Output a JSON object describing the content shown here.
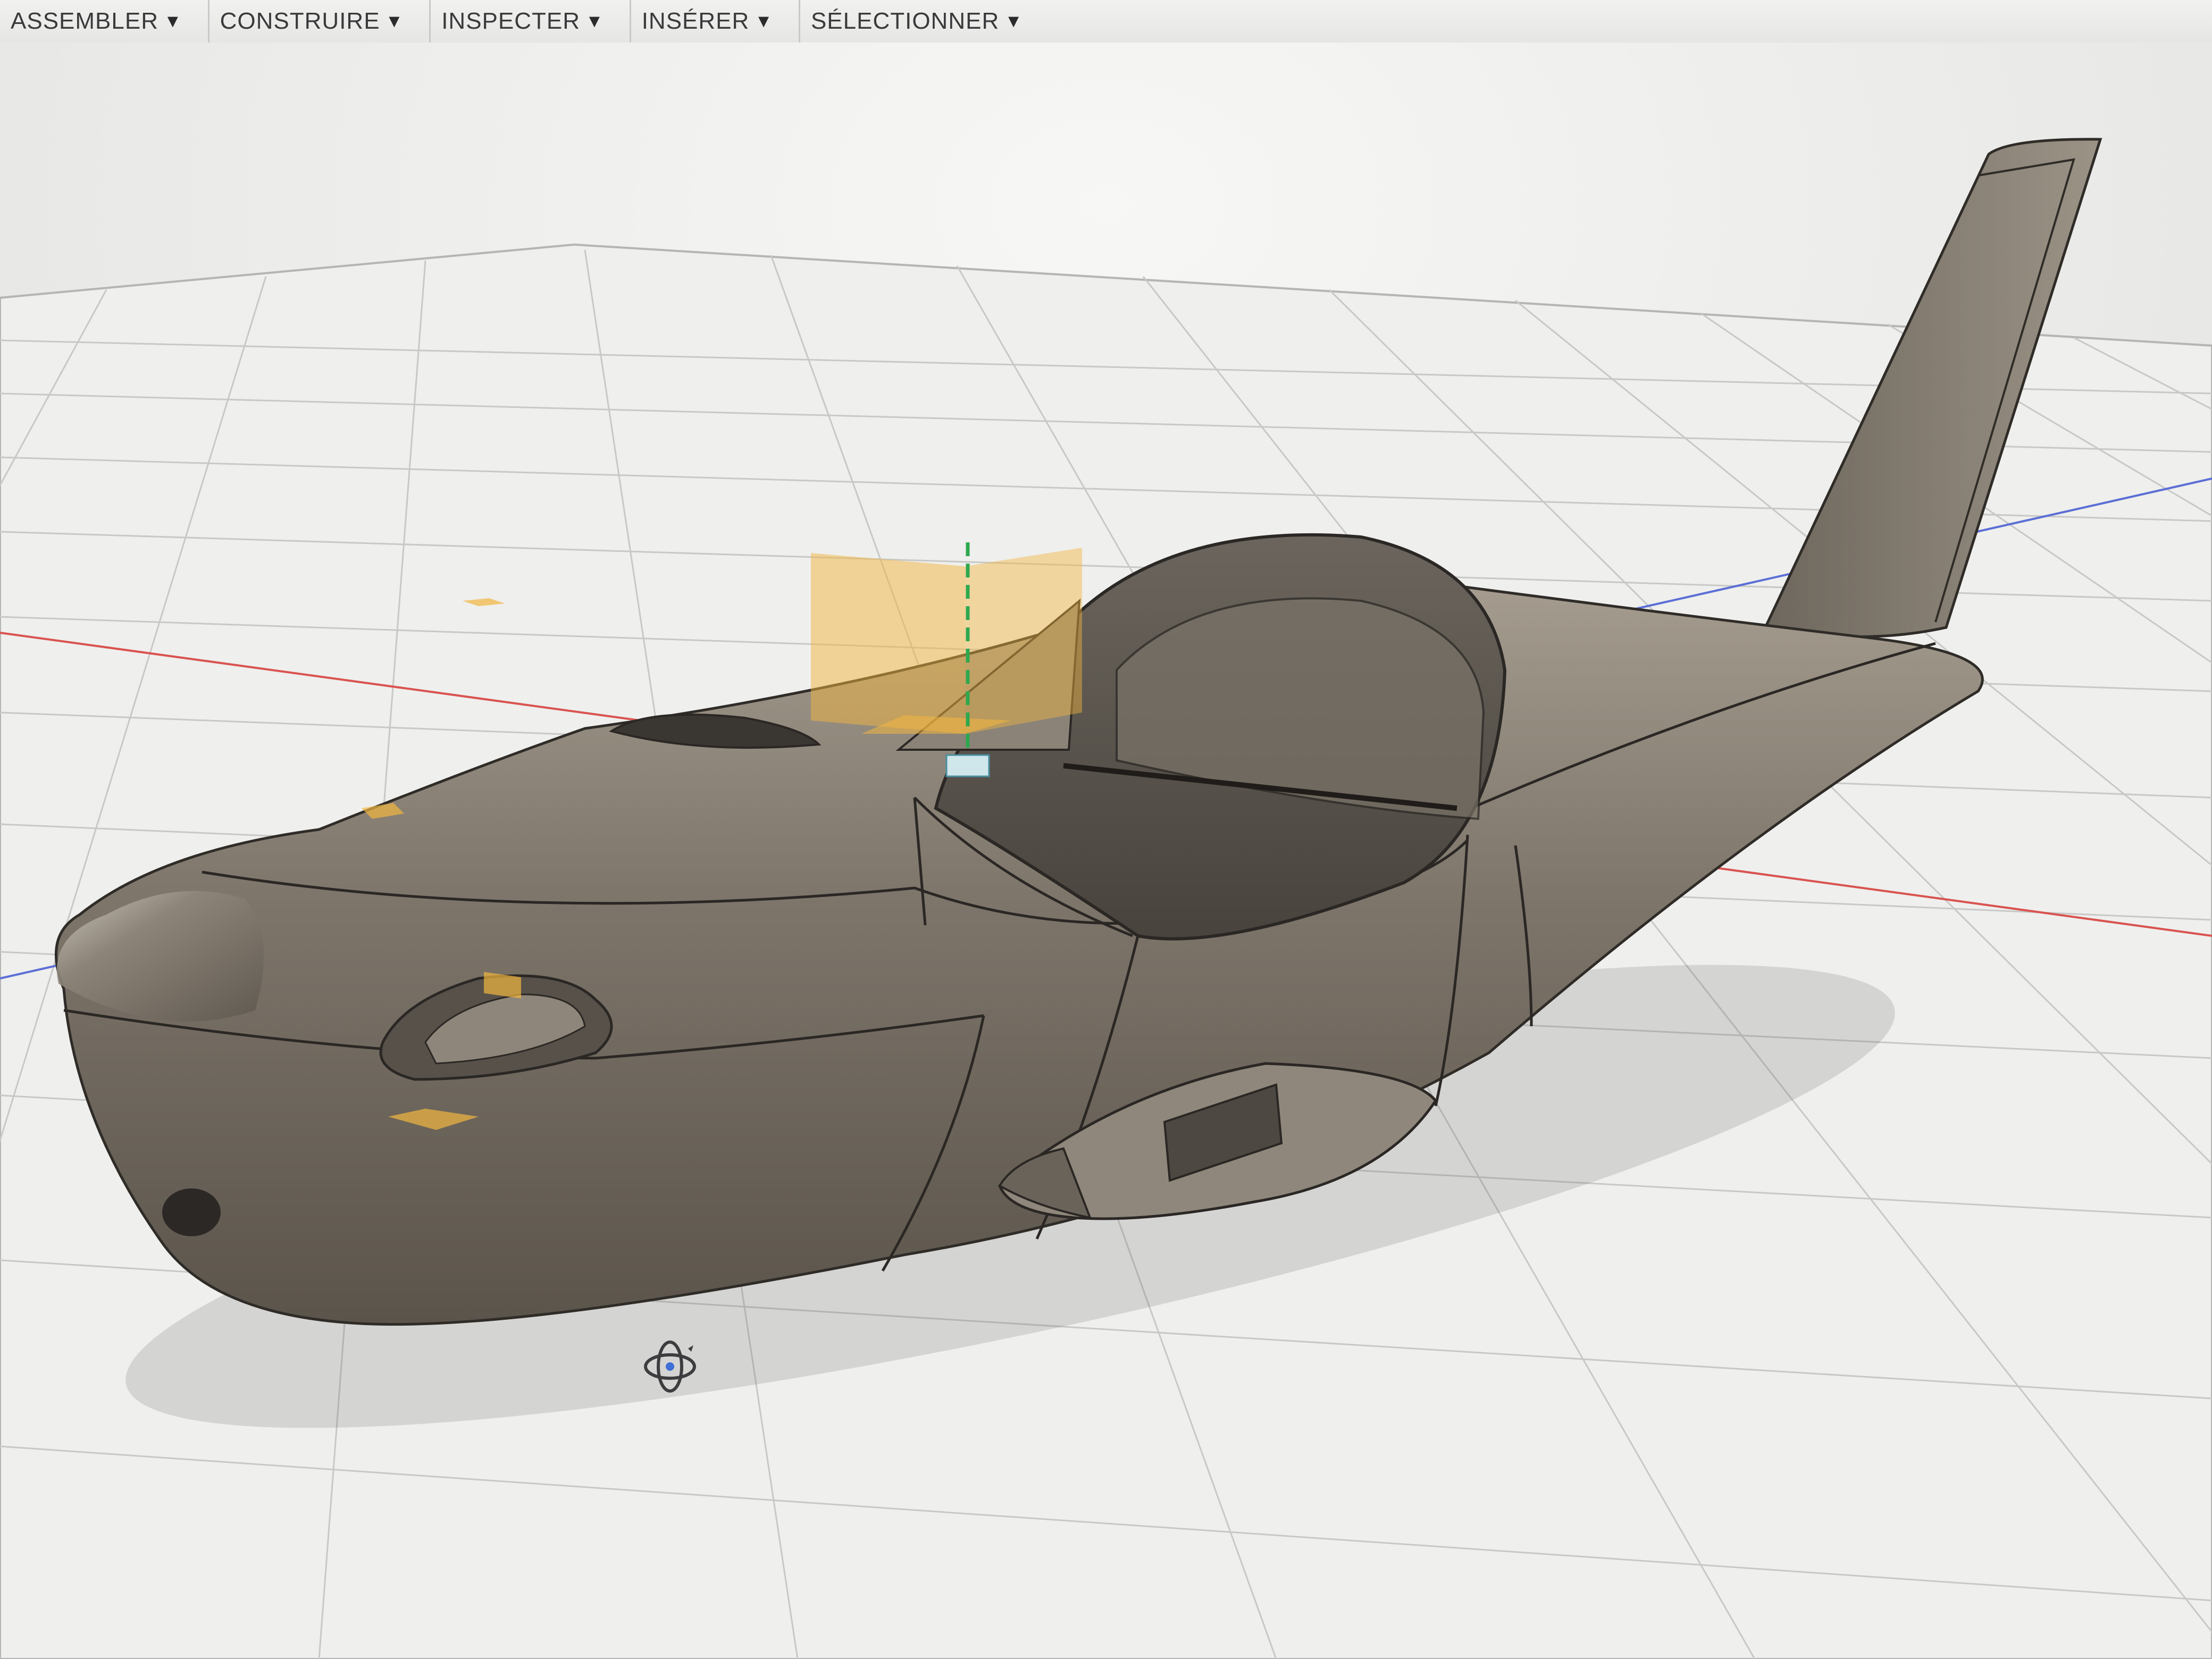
{
  "toolbar": {
    "menus": [
      {
        "label": "ASSEMBLER",
        "icon": "dropdown-arrow-icon"
      },
      {
        "label": "CONSTRUIRE",
        "icon": "dropdown-arrow-icon"
      },
      {
        "label": "INSPECTER",
        "icon": "dropdown-arrow-icon"
      },
      {
        "label": "INSÉRER",
        "icon": "dropdown-arrow-icon"
      },
      {
        "label": "SÉLECTIONNER",
        "icon": "dropdown-arrow-icon"
      }
    ]
  },
  "viewport": {
    "model": "aircraft-fuselage",
    "colors": {
      "background": "#e7e7e5",
      "grid": "#c8c8c6",
      "model_body": "#7d756a",
      "model_highlight": "#a89f92",
      "x_axis": "#d9534f",
      "y_axis": "#2fa84f",
      "z_axis": "#5b6fd6",
      "plane_highlight": "#f2b640"
    },
    "icons": [
      "orbit-icon",
      "origin-plane-icon",
      "axis-triad-icon"
    ]
  }
}
